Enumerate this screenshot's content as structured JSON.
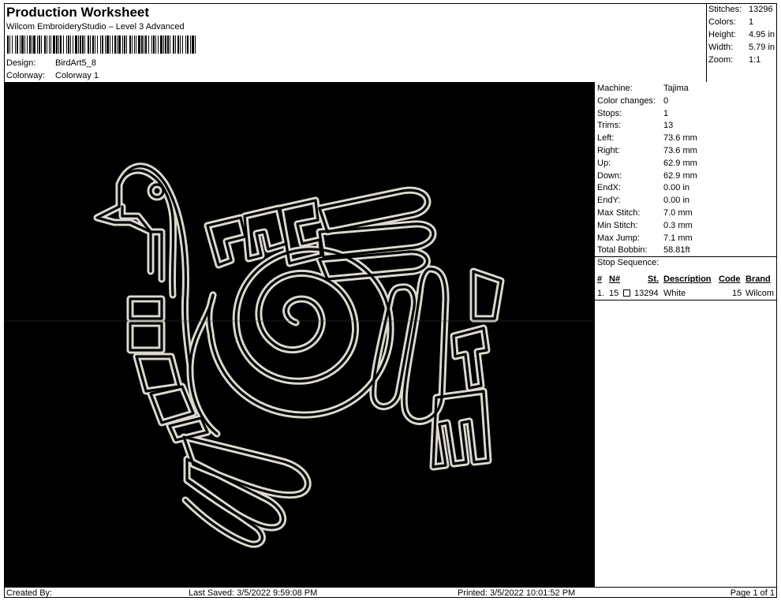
{
  "header": {
    "title": "Production Worksheet",
    "subtitle": "Wilcom EmbroideryStudio – Level 3 Advanced",
    "design_label": "Design:",
    "design_value": "BirdArt5_8",
    "colorway_label": "Colorway:",
    "colorway_value": "Colorway 1"
  },
  "summary": {
    "stitches_label": "Stitches:",
    "stitches_value": "13296",
    "colors_label": "Colors:",
    "colors_value": "1",
    "height_label": "Height:",
    "height_value": "4.95 in",
    "width_label": "Width:",
    "width_value": "5.79 in",
    "zoom_label": "Zoom:",
    "zoom_value": "1:1"
  },
  "machine": [
    {
      "k": "Machine:",
      "v": "Tajima"
    },
    {
      "k": "Color changes:",
      "v": "0"
    },
    {
      "k": "Stops:",
      "v": "1"
    },
    {
      "k": "Trims:",
      "v": "13"
    },
    {
      "k": "Left:",
      "v": "73.6 mm"
    },
    {
      "k": "Right:",
      "v": "73.6 mm"
    },
    {
      "k": "Up:",
      "v": "62.9 mm"
    },
    {
      "k": "Down:",
      "v": "62.9 mm"
    },
    {
      "k": "EndX:",
      "v": "0.00 in"
    },
    {
      "k": "EndY:",
      "v": "0.00 in"
    },
    {
      "k": "Max Stitch:",
      "v": "7.0 mm"
    },
    {
      "k": "Min Stitch:",
      "v": "0.3 mm"
    },
    {
      "k": "Max Jump:",
      "v": "7.1 mm"
    },
    {
      "k": "Total Bobbin:",
      "v": "58.81ft"
    }
  ],
  "stop_sequence": {
    "title": "Stop Sequence:",
    "columns": {
      "num": "#",
      "n": "N#",
      "st": "St.",
      "description": "Description",
      "code": "Code",
      "brand": "Brand"
    },
    "rows": [
      {
        "num": "1.",
        "n": "15",
        "st": "13294",
        "description": "White",
        "code": "15",
        "brand": "Wilcom",
        "color": "#ffffff"
      }
    ]
  },
  "footer": {
    "created_by": "Created By:",
    "last_saved": "Last Saved: 3/5/2022 9:59:08 PM",
    "printed": "Printed: 3/5/2022 10:01:52 PM",
    "page": "Page 1 of 1"
  },
  "design": {
    "background": "#000000",
    "thread_color": "#e8e6dc"
  }
}
